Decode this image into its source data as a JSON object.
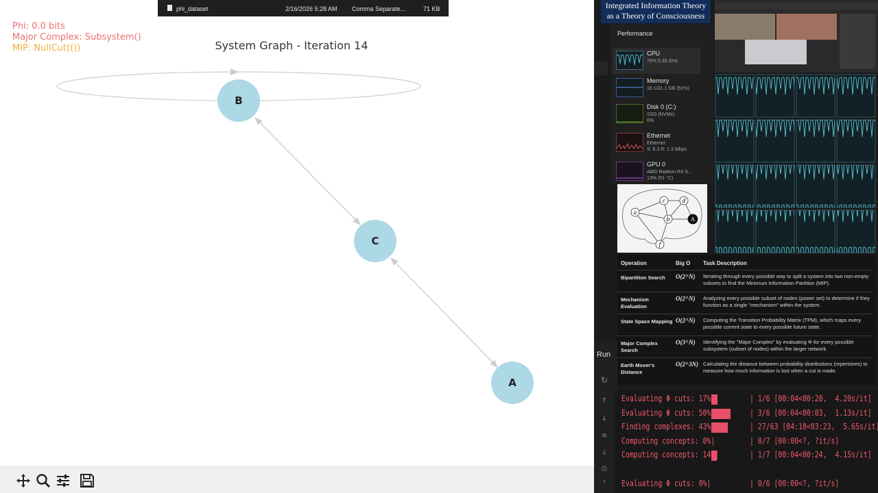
{
  "file_bar": {
    "name": "phi_dataset",
    "date": "2/16/2026 5:28 AM",
    "type": "Comma Separate...",
    "size": "71 KB"
  },
  "plot": {
    "info": {
      "phi": "Phi: 0.0 bits",
      "major_complex": "Major Complex: Subsystem()",
      "mip": "MIP: NullCut(())"
    },
    "title": "System Graph - Iteration 14",
    "nodes": [
      {
        "id": "B",
        "label": "B"
      },
      {
        "id": "C",
        "label": "C"
      },
      {
        "id": "A",
        "label": "A"
      }
    ],
    "edges": [
      {
        "from": "B",
        "to": "B",
        "self_loop": true
      },
      {
        "from": "B",
        "to": "C",
        "bidirectional": true
      },
      {
        "from": "C",
        "to": "A",
        "bidirectional": true
      }
    ],
    "colors": {
      "node": "#add8e6",
      "edge": "#cccccc"
    }
  },
  "toolbar": {
    "tools": [
      "pan-icon",
      "zoom-icon",
      "configure-icon",
      "save-icon"
    ]
  },
  "banner": {
    "line1": "Integrated Information Theory",
    "line2": "as a Theory of Consciousness"
  },
  "performance": {
    "title": "Performance",
    "items": [
      {
        "name": "CPU",
        "sub": "76%  5.35 GHz"
      },
      {
        "name": "Memory",
        "sub": "16.1/31.1 GB (52%)"
      },
      {
        "name": "Disk 0 (C:)",
        "sub": "SSD (NVMe)",
        "sub2": "6%"
      },
      {
        "name": "Ethernet",
        "sub": "Ethernet",
        "sub2": "S: 6.3  R: 1.3 Mbps"
      },
      {
        "name": "GPU 0",
        "sub": "AMD Radeon RX 9...",
        "sub2": "13% (51 °C)"
      }
    ]
  },
  "diagram": {
    "labels": [
      "c",
      "d",
      "a",
      "b",
      "A",
      "f"
    ]
  },
  "complexity_table": {
    "headers": [
      "Operation",
      "Big O",
      "Task Description"
    ],
    "rows": [
      {
        "op": "Bipartition Search",
        "bigo": "O(2^N)",
        "desc": "Iterating through every possible way to split a system into two non-empty subsets to find the Minimum Information Partition (MIP)."
      },
      {
        "op": "Mechanism Evaluation",
        "bigo": "O(2^N)",
        "desc": "Analyzing every possible subset of nodes (power set) to determine if they function as a single \"mechanism\" within the system."
      },
      {
        "op": "State Space Mapping",
        "bigo": "O(2^N)",
        "desc": "Computing the Transition Probability Matrix (TPM), which maps every possible current state to every possible future state."
      },
      {
        "op": "Major Complex Search",
        "bigo": "O(3^N)",
        "desc": "Identifying the \"Major Complex\" by evaluating Φ for every possible subsystem (subset of nodes) within the larger network."
      },
      {
        "op": "Earth Mover's Distance",
        "bigo": "O(2^3N)",
        "desc": "Calculating the distance between probability distributions (repertoires) to measure how much information is lost when a cut is made."
      }
    ]
  },
  "run": {
    "label": "Run"
  },
  "terminal": {
    "lines": [
      {
        "label": "Evaluating Φ cuts:",
        "pct": "17%",
        "progress": 0.17,
        "stats": "| 1/6 [00:04<00:20,  4.20s/it]"
      },
      {
        "label": "Evaluating Φ cuts:",
        "pct": "50%",
        "progress": 0.5,
        "stats": "| 3/6 [00:04<00:03,  1.13s/it]"
      },
      {
        "label": "Finding complexes:",
        "pct": "43%",
        "progress": 0.43,
        "stats": "| 27/63 [04:18<03:23,  5.65s/it]"
      },
      {
        "label": "Computing concepts:",
        "pct": "0%",
        "progress": 0,
        "stats": "| 0/7 [00:00<?, ?it/s]"
      },
      {
        "label": "Computing concepts:",
        "pct": "14%",
        "progress": 0.14,
        "stats": "| 1/7 [00:04<00:24,  4.15s/it]"
      },
      {
        "label": "Evaluating Φ cuts:",
        "pct": "0%",
        "progress": 0,
        "stats": "| 0/6 [00:00<?, ?it/s]"
      }
    ]
  }
}
